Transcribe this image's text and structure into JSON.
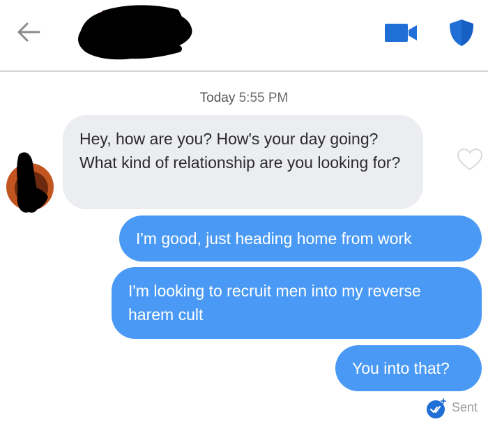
{
  "header": {
    "back_icon": "arrow-left-icon",
    "profile_name_redacted": true,
    "video_icon": "video-camera-icon",
    "safety_icon": "shield-icon",
    "accent_color": "#1f6fd6"
  },
  "conversation": {
    "timestamp": {
      "day": "Today",
      "time": "5:55 PM"
    },
    "messages": [
      {
        "direction": "received",
        "text": "Hey, how are you? How's your day going? What kind of relationship are you looking for?",
        "like_icon": "heart-outline-icon"
      },
      {
        "direction": "sent",
        "text": "I'm good, just heading home from work"
      },
      {
        "direction": "sent",
        "text": "I'm looking to recruit men into my reverse harem cult"
      },
      {
        "direction": "sent",
        "text": "You into that?"
      }
    ],
    "status": {
      "label": "Sent",
      "icon": "sent-check-icon"
    }
  },
  "colors": {
    "sent_bubble": "#4a9af5",
    "received_bubble": "#ecedf1",
    "header_icons": "#1f6fd6"
  }
}
